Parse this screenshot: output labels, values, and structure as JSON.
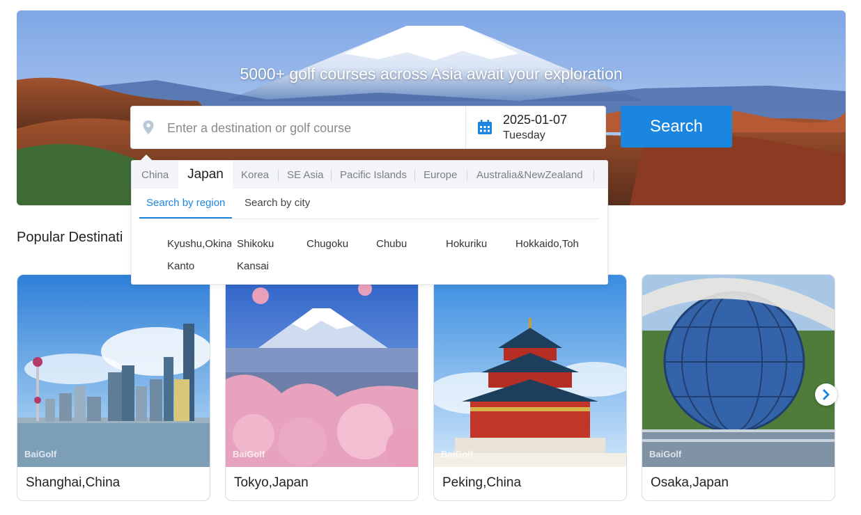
{
  "hero": {
    "tagline": "5000+ golf courses across Asia await your exploration"
  },
  "search": {
    "placeholder": "Enter a destination or golf course",
    "date": "2025-01-07",
    "weekday": "Tuesday",
    "button_label": "Search"
  },
  "dropdown": {
    "region_tabs": [
      {
        "label": "China",
        "active": false
      },
      {
        "label": "Japan",
        "active": true
      },
      {
        "label": "Korea",
        "active": false
      },
      {
        "label": "SE Asia",
        "active": false
      },
      {
        "label": "Pacific Islands",
        "active": false
      },
      {
        "label": "Europe",
        "active": false
      },
      {
        "label": "Australia&NewZealand",
        "active": false
      }
    ],
    "mode_tabs": [
      {
        "label": "Search by region",
        "active": true
      },
      {
        "label": "Search by city",
        "active": false
      }
    ],
    "regions": [
      "Kyushu,Okina",
      "Shikoku",
      "Chugoku",
      "Chubu",
      "Hokuriku",
      "Hokkaido,Toh",
      "Kanto",
      "Kansai"
    ]
  },
  "popular": {
    "title": "Popular Destinati",
    "watermark": "BaiGolf",
    "cards": [
      {
        "label": "Shanghai,China"
      },
      {
        "label": "Tokyo,Japan"
      },
      {
        "label": "Peking,China"
      },
      {
        "label": "Osaka,Japan"
      }
    ]
  },
  "colors": {
    "accent": "#1a86e0",
    "tab_bar": "#f3f4f7"
  },
  "icons": {
    "location": "map-pin-icon",
    "calendar": "calendar-icon",
    "next": "chevron-right-icon"
  }
}
